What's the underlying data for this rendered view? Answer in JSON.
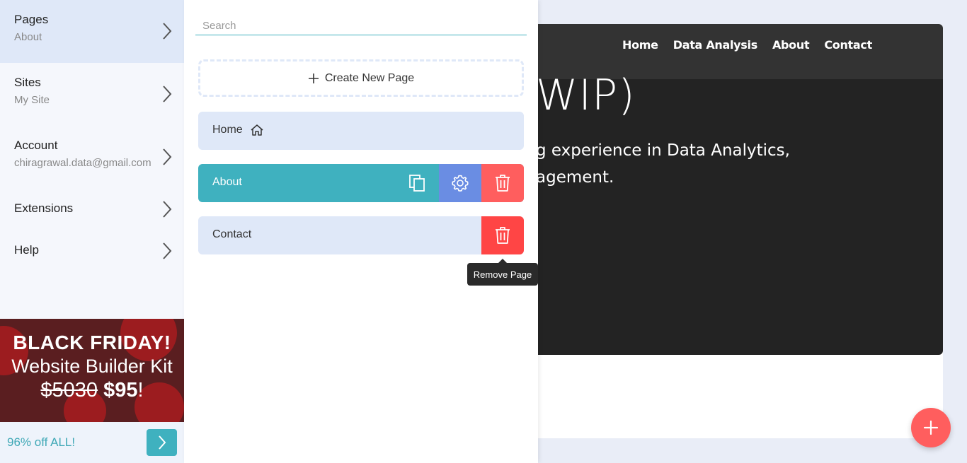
{
  "preview": {
    "nav": [
      "Home",
      "Data Analysis",
      "About",
      "Contact"
    ],
    "hero_title": "WIP)",
    "hero_line_1": "g experience in Data Analytics,",
    "hero_line_2": "agement."
  },
  "sidebar": {
    "items": [
      {
        "title": "Pages",
        "sub": "About"
      },
      {
        "title": "Sites",
        "sub": "My Site"
      },
      {
        "title": "Account",
        "sub": "chiragrawal.data@gmail.com"
      },
      {
        "title": "Extensions",
        "sub": ""
      },
      {
        "title": "Help",
        "sub": ""
      }
    ]
  },
  "promo": {
    "line1": "BLACK FRIDAY!",
    "line2": "Website Builder Kit",
    "old_price": "$5030",
    "new_price": "$95",
    "suffix": "!",
    "bar_text": "96% off ALL!"
  },
  "panel": {
    "search_placeholder": "Search",
    "create_label": "Create New Page",
    "pages": [
      {
        "label": "Home"
      },
      {
        "label": "About"
      },
      {
        "label": "Contact"
      }
    ],
    "tooltip": "Remove Page"
  },
  "colors": {
    "accent": "#3fb1bf",
    "settings": "#6a8de3",
    "danger": "#ff5e5e",
    "danger_hover": "#ff4545"
  },
  "icons": [
    "chevron-right-icon",
    "plus-icon",
    "home-icon",
    "copy-icon",
    "gear-icon",
    "trash-icon"
  ]
}
